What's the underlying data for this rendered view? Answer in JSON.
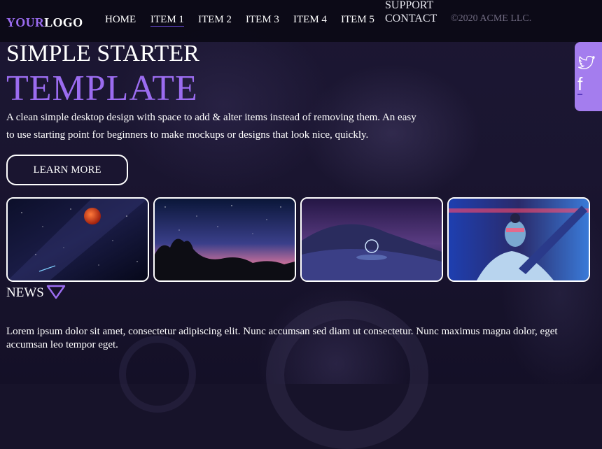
{
  "brand": {
    "logo_part1": "YOUR",
    "logo_part2": "LOGO"
  },
  "nav": {
    "items": [
      "HOME",
      "ITEM 1",
      "ITEM 2",
      "ITEM 3",
      "ITEM 4",
      "ITEM 5"
    ],
    "support": "SUPPORT",
    "contact": "CONTACT",
    "copyright": "©2020 ACME LLC."
  },
  "social": {
    "twitter_icon": "twitter-icon",
    "facebook_icon": "facebook-icon",
    "facebook_glyph": "f"
  },
  "hero": {
    "subtitle": "SIMPLE STARTER",
    "title": "TEMPLATE",
    "description": "A clean simple desktop design with space to add & alter items instead of removing them. An easy to use starting point for beginners to make mockups or designs that look nice, quickly.",
    "button_label": "LEARN MORE"
  },
  "gallery": [
    {
      "name": "night-sky-red-moon"
    },
    {
      "name": "starry-sky-rocks"
    },
    {
      "name": "snowy-hill-light-orb"
    },
    {
      "name": "cyber-robot"
    }
  ],
  "news": {
    "heading": "NEWS",
    "body": "Lorem ipsum dolor sit amet, consectetur adipiscing elit. Nunc accumsan sed diam ut consectetur. Nunc maximus magna dolor, eget accumsan leo tempor eget."
  },
  "colors": {
    "accent": "#9b6cf0",
    "sidebar": "#a47dee",
    "navbar": "#08060f"
  }
}
